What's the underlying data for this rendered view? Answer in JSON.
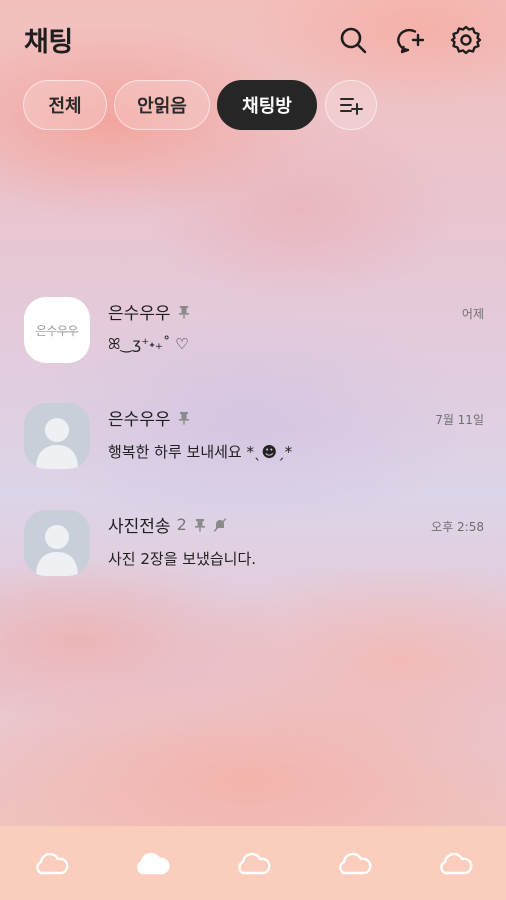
{
  "header": {
    "title": "채팅"
  },
  "filters": [
    {
      "label": "전체"
    },
    {
      "label": "안읽음"
    },
    {
      "label": "채팅방",
      "active": true
    }
  ],
  "chats": [
    {
      "name": "은수우우",
      "count": "",
      "avatar_text": "은수우우",
      "preview": "ꕤ‿ʒ⁺˖₊˚ ♡",
      "time": "어제",
      "pinned": true,
      "muted": false
    },
    {
      "name": "은수우우",
      "count": "",
      "avatar_text": "",
      "preview": "행복한 하루 보내세요 *ˎ☻ˏ*",
      "time": "7월 11일",
      "pinned": true,
      "muted": false
    },
    {
      "name": "사진전송",
      "count": "2",
      "avatar_text": "",
      "preview": "사진 2장을 보냈습니다.",
      "time": "오후 2:58",
      "pinned": true,
      "muted": true
    }
  ],
  "icons": {
    "search": "search-icon",
    "new_chat": "new-chat-icon",
    "settings": "gear-icon",
    "edit_filter": "list-add-icon",
    "pin": "pin-icon",
    "mute": "mute-icon",
    "nav": [
      "cloud-icon",
      "cloud-icon",
      "cloud-icon",
      "cloud-icon",
      "cloud-icon"
    ]
  },
  "colors": {
    "active_chip": "#262626",
    "bottom_bar": "#fbcdbd"
  },
  "bottom_nav": {
    "active_index": 1
  }
}
